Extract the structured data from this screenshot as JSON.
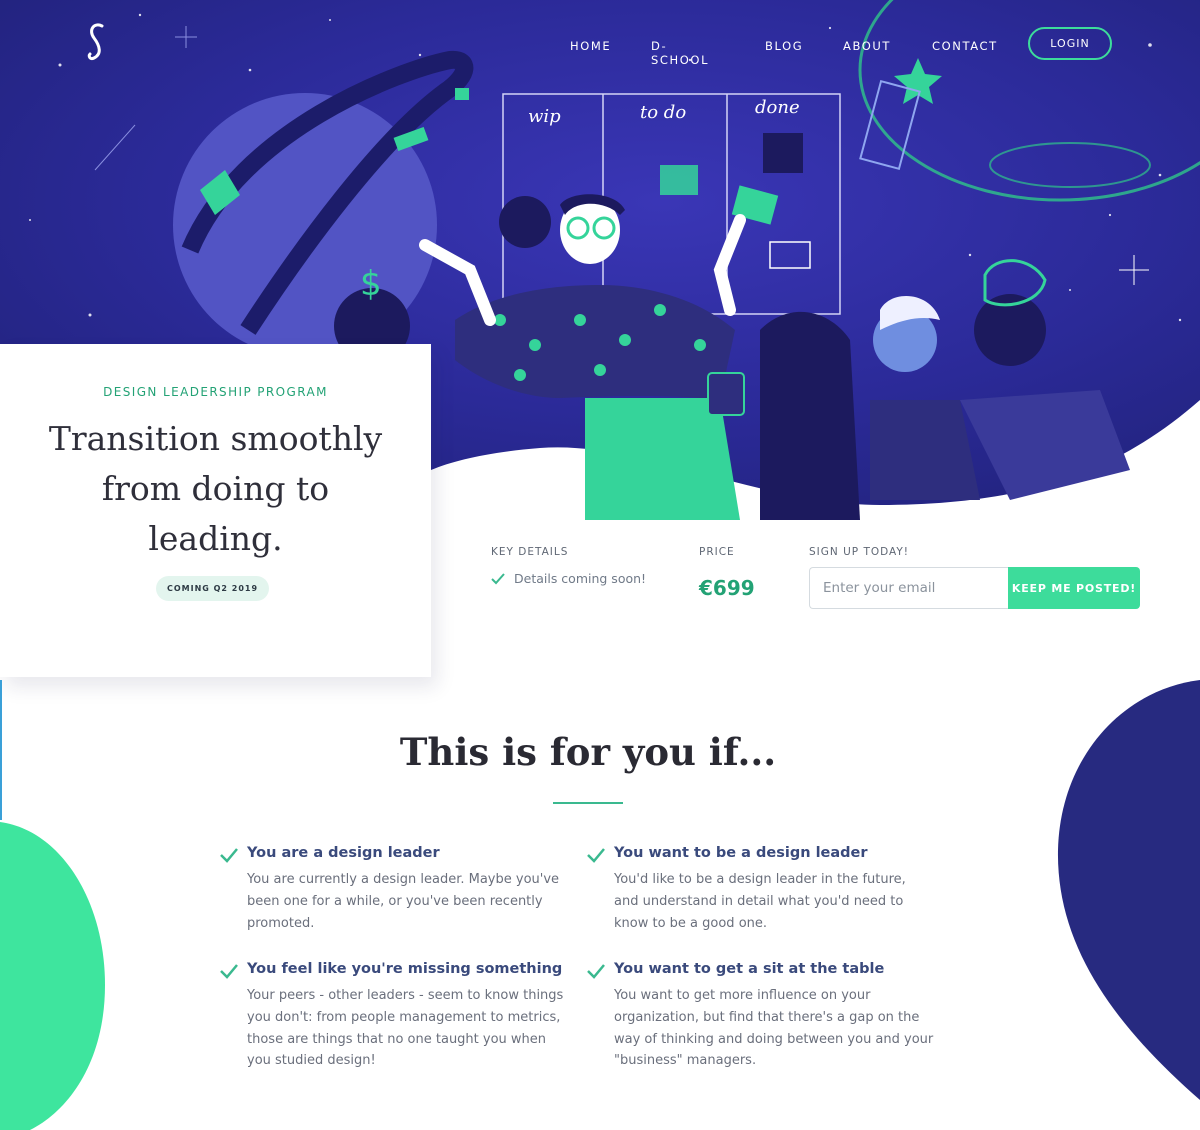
{
  "nav": {
    "items": [
      {
        "label": "HOME"
      },
      {
        "label": "D-SCHOOL"
      },
      {
        "label": "BLOG"
      },
      {
        "label": "ABOUT"
      },
      {
        "label": "CONTACT"
      }
    ],
    "login_label": "LOGIN"
  },
  "hero": {
    "illustration_board": [
      "wip",
      "to do",
      "done"
    ]
  },
  "card": {
    "eyebrow": "DESIGN LEADERSHIP PROGRAM",
    "headline": "Transition smoothly from doing to leading.",
    "badge": "COMING Q2 2019"
  },
  "details": {
    "key_label": "KEY DETAILS",
    "key_item": "Details coming soon!",
    "price_label": "PRICE",
    "price": "€699",
    "signup_label": "SIGN UP TODAY!",
    "email_placeholder": "Enter your email",
    "cta_label": "KEEP ME POSTED!"
  },
  "section": {
    "title": "This is for you if...",
    "benefits": [
      {
        "title": "You are a design leader",
        "text": "You are currently a design leader. Maybe you've been one for a while, or you've been recently promoted."
      },
      {
        "title": "You want to be a design leader",
        "text": "You'd like to be a design leader in the future, and understand in detail what you'd need to know to be a good one."
      },
      {
        "title": "You feel like you're missing something",
        "text": "Your peers - other leaders - seem to know things you don't: from people management to metrics, those are things that no one taught you when you studied design!"
      },
      {
        "title": "You want to get a sit at the table",
        "text": "You want to get more influence on your organization, but find that there's a gap on the way of thinking and doing between you and your \"business\" managers."
      }
    ]
  },
  "colors": {
    "hero_bg": "#2a2a9a",
    "accent_green": "#3ddc9b",
    "dark_green_text": "#23a275",
    "navy_blob": "#272a80",
    "benefit_title": "#3a4a7c"
  }
}
